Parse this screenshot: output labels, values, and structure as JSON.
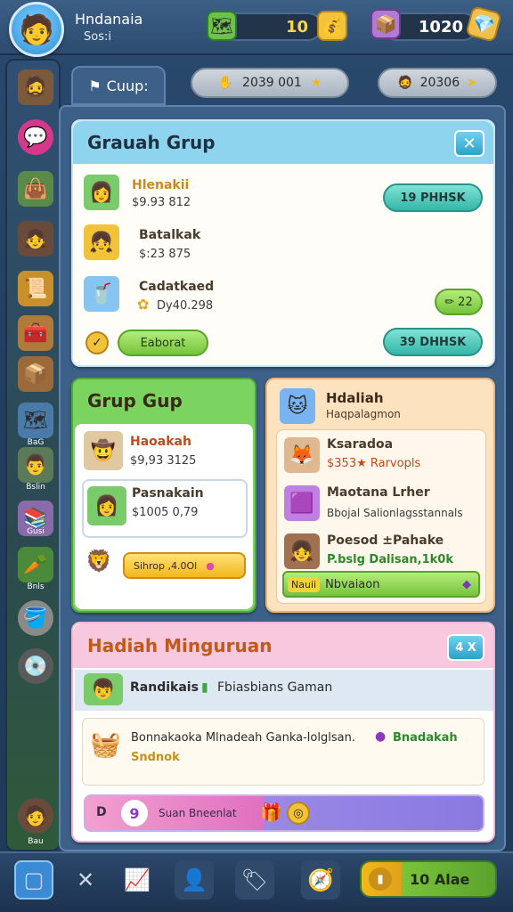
{
  "player": {
    "name": "Hndanaia",
    "sub": "Sos:i",
    "avatar_icon": "player-avatar-icon"
  },
  "resources": {
    "gold": "10",
    "gems": "1020"
  },
  "sidebar": {
    "labels": [
      "BaG",
      "Bslin",
      "Gusi",
      "Bnls",
      "Bau"
    ]
  },
  "group_tab": {
    "label": "Cuup:"
  },
  "top_prices": {
    "left": "2039 001",
    "right": "20306"
  },
  "grup_panel": {
    "title": "Grauah Grup",
    "rows": [
      {
        "name": "Hlenakii",
        "value": "$9.93 812",
        "button": "19 PHHSK"
      },
      {
        "name": "Batalkak",
        "value": "$:23 875"
      },
      {
        "name": "Cadatkaed",
        "value": "Dy40.298",
        "button": "22"
      }
    ],
    "secondary_button": "Eaborat",
    "bottom_button": "39 DHHSK"
  },
  "grup_gup": {
    "title": "Grup Gup",
    "rows": [
      {
        "name": "Haoakah",
        "value": "$9,93 3125"
      },
      {
        "name": "Pasnakain",
        "value": "$1005 0,79"
      }
    ],
    "button": "Sihrop ,4.0Ol"
  },
  "hadiah": {
    "title": "Hdaliah",
    "subtitle": "Haqpalagmon",
    "rows": [
      {
        "name": "Ksaradoa",
        "value": "$353★ Rarvopls"
      },
      {
        "name": "Maotana Lrher",
        "value": "Bbojal Salionlagsstannals"
      },
      {
        "name": "Poesod ±Pahake",
        "value": "P.bslg Dalisan,1k0k"
      }
    ],
    "button_label": "Nauii",
    "button_text": "Nbvaiaon"
  },
  "mingguan": {
    "title": "Hadiah Minguruan",
    "close_label": "4 X",
    "row1_name": "Randikais",
    "row1_desc": "Fbiasbians Gaman",
    "row2_text": "Bonnakaoka Mlnadeah Ganka-lolglsan.",
    "row2_highlight": "Bnadakah",
    "row2_sub": "Sndnok",
    "bar_left": "D",
    "bar_num": "9",
    "bar_text": "Suan Bneenlat"
  },
  "bottom_nav": {
    "button": "10 Alae"
  }
}
